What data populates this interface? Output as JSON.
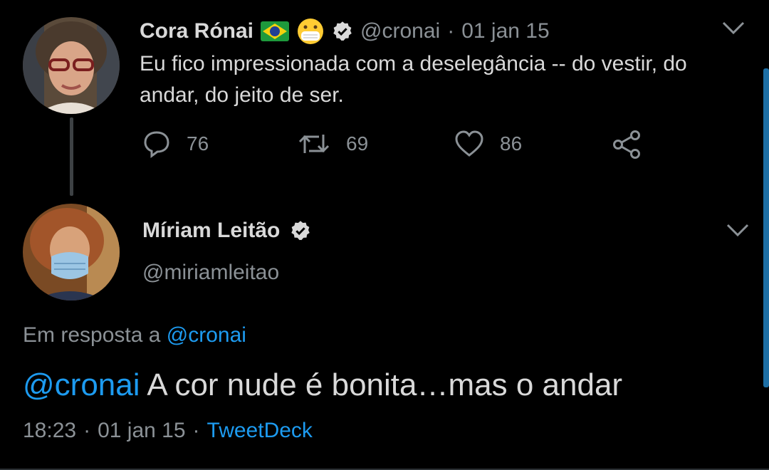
{
  "tweet1": {
    "author_name": "Cora Rónai",
    "handle": "@cronai",
    "separator": "·",
    "date": "01 jan 15",
    "text": "Eu fico impressionada com a deselegância -- do vestir, do andar, do jeito de ser.",
    "counts": {
      "replies": "76",
      "retweets": "69",
      "likes": "86"
    }
  },
  "tweet2": {
    "author_name": "Míriam Leitão",
    "handle": "@miriamleitao",
    "reply_prefix": "Em resposta a",
    "reply_to": "@cronai",
    "mention": "@cronai",
    "text": " A cor nude é bonita…mas o andar",
    "time": "18:23",
    "sep1": "·",
    "date": "01 jan 15",
    "sep2": "·",
    "source": "TweetDeck"
  },
  "icons": {
    "flag": "brazil-flag-icon",
    "mask_emoji": "face-with-mask-icon",
    "verified": "verified-badge-icon",
    "reply": "reply-icon",
    "retweet": "retweet-icon",
    "like": "heart-icon",
    "share": "share-icon",
    "more": "chevron-down-icon"
  },
  "colors": {
    "background": "#000000",
    "text": "#d9d9d9",
    "muted": "#8b9196",
    "link": "#1d9bf0"
  }
}
